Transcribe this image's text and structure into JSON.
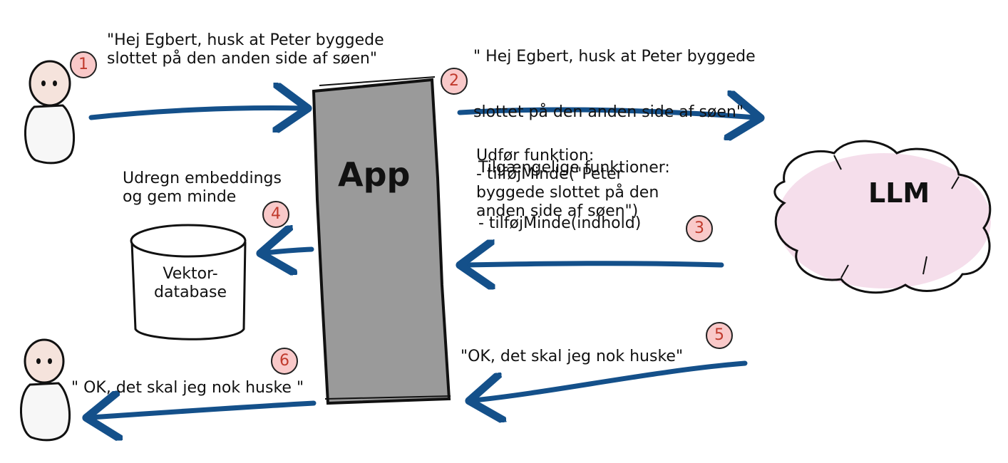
{
  "diagram": {
    "app_label": "App",
    "llm_label": "LLM",
    "db_label_lines": [
      "Vektor-",
      "database"
    ],
    "step1": {
      "num": "1",
      "lines": [
        "\"Hej Egbert, husk at Peter byggede",
        "slottet på den anden side af søen\""
      ]
    },
    "step2": {
      "num": "2",
      "lines": [
        "\" Hej Egbert, husk at Peter byggede",
        "slottet på den anden side af søen\"",
        " Tilgængelige funktioner:",
        " - tilføjMinde(indhold)"
      ]
    },
    "step3": {
      "num": "3",
      "lines": [
        "Udfør funktion:",
        "- tilføjMinde(\"Peter",
        "byggede slottet på den",
        "anden side af søen\")"
      ]
    },
    "step4": {
      "num": "4",
      "lines": [
        "Udregn embeddings",
        "og gem minde"
      ]
    },
    "step5": {
      "num": "5",
      "lines": [
        "\"OK, det skal jeg nok huske\""
      ]
    },
    "step6": {
      "num": "6",
      "lines": [
        "\" OK, det skal jeg nok huske \""
      ]
    },
    "colors": {
      "arrow": "#14508a",
      "app_fill": "#9a9a9a",
      "llm_fill": "#f3d6e6",
      "badge_fill": "#f9c9c9",
      "badge_text": "#c0392b",
      "face": "#f5e3dc"
    }
  }
}
